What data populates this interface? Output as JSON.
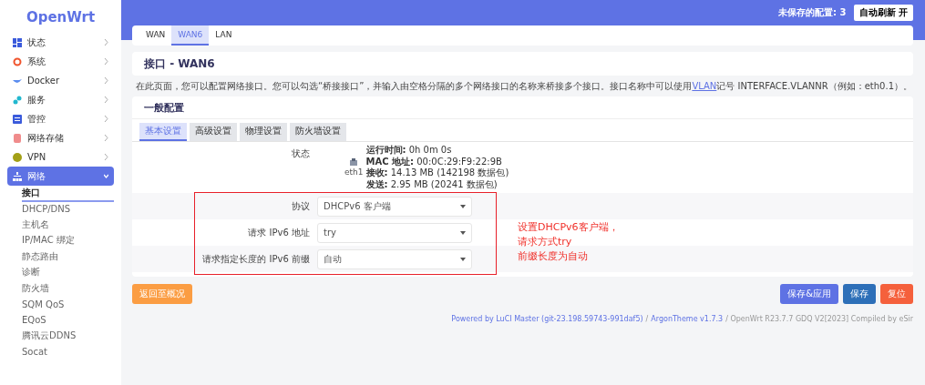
{
  "sidebar": {
    "logo": "OpenWrt",
    "items": [
      {
        "label": "状态",
        "expanded": false,
        "color": "#3b5bdb"
      },
      {
        "label": "系统",
        "expanded": false,
        "color": "#f0542d"
      },
      {
        "label": "Docker",
        "expanded": false,
        "color": "#5b8def"
      },
      {
        "label": "服务",
        "expanded": false,
        "color": "#22b8cf"
      },
      {
        "label": "管控",
        "expanded": false,
        "color": "#3b5bdb"
      },
      {
        "label": "网络存储",
        "expanded": false,
        "color": "#f08c8c"
      },
      {
        "label": "VPN",
        "expanded": false,
        "color": "#a3a017"
      },
      {
        "label": "网络",
        "expanded": true,
        "color": "#ffffff",
        "children": [
          {
            "label": "接口",
            "selected": true
          },
          {
            "label": "DHCP/DNS",
            "selected": false
          },
          {
            "label": "主机名",
            "selected": false
          },
          {
            "label": "IP/MAC 绑定",
            "selected": false
          },
          {
            "label": "静态路由",
            "selected": false
          },
          {
            "label": "诊断",
            "selected": false
          },
          {
            "label": "防火墙",
            "selected": false
          },
          {
            "label": "SQM QoS",
            "selected": false
          },
          {
            "label": "EQoS",
            "selected": false
          },
          {
            "label": "腾讯云DDNS",
            "selected": false
          },
          {
            "label": "Socat",
            "selected": false
          }
        ]
      }
    ]
  },
  "header": {
    "unsaved": "未保存的配置: 3",
    "refresh_button": "自动刷新 开"
  },
  "tabs": [
    {
      "label": "WAN",
      "selected": false
    },
    {
      "label": "WAN6",
      "selected": true
    },
    {
      "label": "LAN",
      "selected": false
    }
  ],
  "title": "接口 - WAN6",
  "description": [
    {
      "text": "在此页面，您可以配置网络接口。您可以勾选“桥接接口”，并输入由空格分隔的多个网络接口的名称来桥接多个接口。接口名称中可以使用",
      "kind": "plain"
    },
    {
      "text": "VLAN",
      "kind": "link"
    },
    {
      "text": "记号 INTERFACE.VLANNR（例如：eth0.1）。",
      "kind": "plain"
    }
  ],
  "section": {
    "heading": "一般配置",
    "subtabs": [
      {
        "label": "基本设置",
        "selected": true
      },
      {
        "label": "高级设置",
        "selected": false
      },
      {
        "label": "物理设置",
        "selected": false
      },
      {
        "label": "防火墙设置",
        "selected": false
      }
    ],
    "status": {
      "label": "状态",
      "device": "eth1",
      "lines": [
        {
          "key": "运行时间:",
          "value": "0h 0m 0s"
        },
        {
          "key": "MAC 地址:",
          "value": "00:0C:29:F9:22:9B"
        },
        {
          "key": "接收:",
          "value": "14.13 MB (142198 数据包)"
        },
        {
          "key": "发送:",
          "value": "2.95 MB (20241 数据包)"
        }
      ]
    },
    "fields": [
      {
        "label": "协议",
        "value": "DHCPv6 客户端"
      },
      {
        "label": "请求 IPv6 地址",
        "value": "try"
      },
      {
        "label": "请求指定长度的 IPv6 前缀",
        "value": "自动"
      }
    ]
  },
  "annotation": {
    "lines": [
      "设置DHCPv6客户端，",
      "请求方式try",
      "前缀长度为自动"
    ]
  },
  "buttons": [
    {
      "label": "返回至概况",
      "kind": "back"
    },
    {
      "label": "保存&应用",
      "kind": "apply"
    },
    {
      "label": "保存",
      "kind": "save"
    },
    {
      "label": "复位",
      "kind": "reset"
    }
  ],
  "footer": [
    {
      "text": "Powered by LuCI Master (git-23.198.59743-991daf5)",
      "kind": "link"
    },
    {
      "text": "/",
      "kind": "plain"
    },
    {
      "text": "ArgonTheme v1.7.3",
      "kind": "link"
    },
    {
      "text": "/ OpenWrt R23.7.7 GDQ V2[2023] Compiled by eSir",
      "kind": "plain"
    }
  ]
}
